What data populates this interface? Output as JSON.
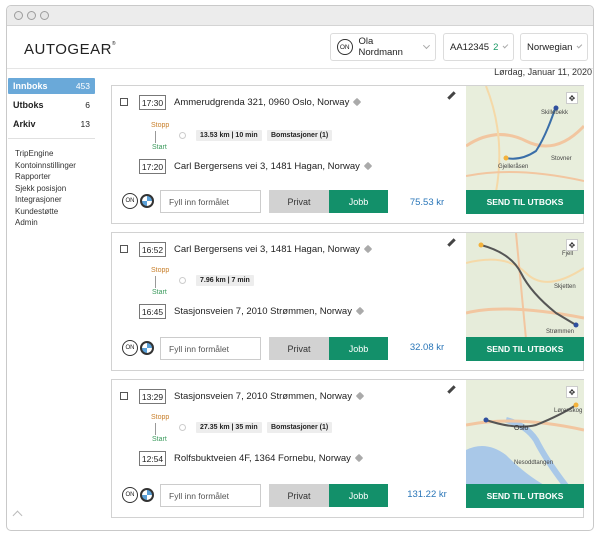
{
  "header": {
    "logo": "AUTOGEAR",
    "user_badge": "ON",
    "user_name": "Ola Nordmann",
    "vehicle_id": "AA12345",
    "vehicle_count": "2",
    "language": "Norwegian"
  },
  "date": "Lørdag, Januar 11, 2020",
  "sidebar": {
    "folders": [
      {
        "label": "Innboks",
        "count": "453"
      },
      {
        "label": "Utboks",
        "count": "6"
      },
      {
        "label": "Arkiv",
        "count": "13"
      }
    ],
    "links": [
      "TripEngine",
      "Kontoinnstillinger",
      "Rapporter",
      "Sjekk posisjon",
      "Integrasjoner",
      "Kundestøtte",
      "Admin"
    ]
  },
  "common": {
    "stop_label": "Stopp",
    "start_label": "Start",
    "purpose_placeholder": "Fyll inn formålet",
    "privat_label": "Privat",
    "jobb_label": "Jobb",
    "send_label": "SEND TIL UTBOKS",
    "on_badge": "ON"
  },
  "trips": [
    {
      "start_time": "17:30",
      "start_address": "Ammerudgrenda 321, 0960 Oslo, Norway",
      "distance": "13.53 km | 10 min",
      "toll": "Bomstasjoner (1)",
      "end_time": "17:20",
      "end_address": "Carl Bergersens vei 3, 1481 Hagan, Norway",
      "amount": "75.53 kr",
      "map_labels": [
        "Skillebekk",
        "Stovner",
        "Gjelleråsen"
      ]
    },
    {
      "start_time": "16:52",
      "start_address": "Carl Bergersens vei 3, 1481 Hagan, Norway",
      "distance": "7.96 km | 7 min",
      "toll": "",
      "end_time": "16:45",
      "end_address": "Stasjonsveien 7, 2010 Strømmen, Norway",
      "amount": "32.08 kr",
      "map_labels": [
        "Fjell",
        "Skjetten",
        "Strømmen"
      ]
    },
    {
      "start_time": "13:29",
      "start_address": "Stasjonsveien 7, 2010 Strømmen, Norway",
      "distance": "27.35 km | 35 min",
      "toll": "Bomstasjoner (1)",
      "end_time": "12:54",
      "end_address": "Rolfsbuktveien 4F, 1364 Fornebu, Norway",
      "amount": "131.22 kr",
      "map_labels": [
        "Oslo",
        "Lørenskog",
        "Nesoddtangen"
      ]
    }
  ],
  "colors": {
    "accent_green": "#13906a",
    "active_blue": "#6aa9d9",
    "amount_blue": "#2a76b8",
    "stop_orange": "#c87f2a",
    "start_green": "#3a9a5c"
  }
}
